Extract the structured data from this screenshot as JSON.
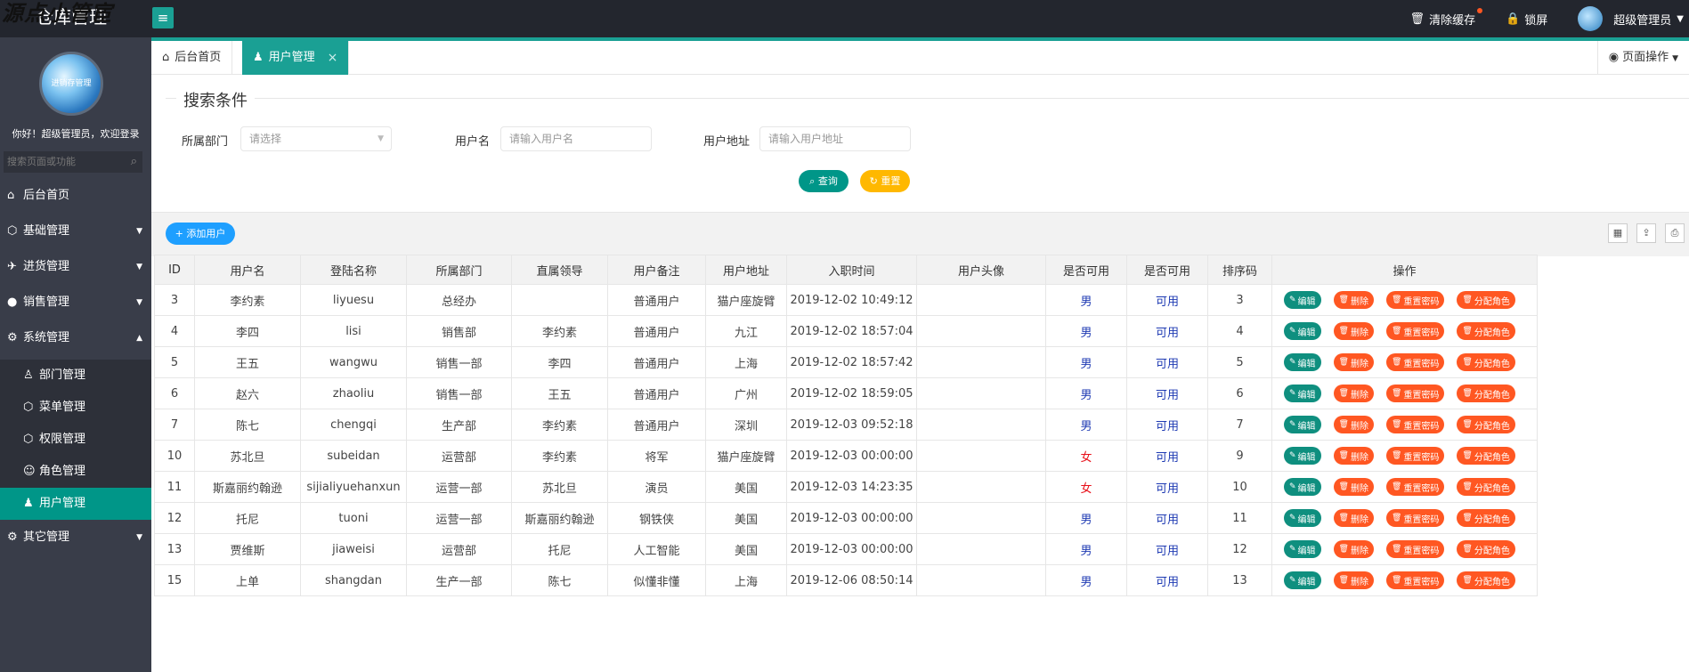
{
  "topbar": {
    "title": "仓库管理",
    "watermark": "源点小管宦",
    "clear_cache": "清除缓存",
    "lock_screen": "锁屏",
    "user": "超级管理员"
  },
  "sidebar": {
    "avatar_text": "进销存管理",
    "welcome": "你好！超级管理员，欢迎登录",
    "search_placeholder": "搜索页面或功能",
    "items": [
      {
        "label": "后台首页"
      },
      {
        "label": "基础管理"
      },
      {
        "label": "进货管理"
      },
      {
        "label": "销售管理"
      },
      {
        "label": "系统管理"
      },
      {
        "label": "其它管理"
      }
    ],
    "sub_items": [
      {
        "label": "部门管理"
      },
      {
        "label": "菜单管理"
      },
      {
        "label": "权限管理"
      },
      {
        "label": "角色管理"
      },
      {
        "label": "用户管理"
      }
    ]
  },
  "tabs": {
    "home": "后台首页",
    "current": "用户管理",
    "close": "×",
    "page_ops": "页面操作"
  },
  "search": {
    "title": "搜索条件",
    "dept_label": "所属部门",
    "dept_placeholder": "请选择",
    "name_label": "用户名",
    "name_placeholder": "请输入用户名",
    "addr_label": "用户地址",
    "addr_placeholder": "请输入用户地址",
    "query_btn": "查询",
    "reset_btn": "重置"
  },
  "toolbar": {
    "add_user": "添加用户"
  },
  "table": {
    "headers": [
      "ID",
      "用户名",
      "登陆名称",
      "所属部门",
      "直属领导",
      "用户备注",
      "用户地址",
      "入职时间",
      "用户头像",
      "是否可用",
      "是否可用",
      "排序码",
      "操作"
    ],
    "actions": {
      "edit": "编辑",
      "delete": "删除",
      "reset_pwd": "重置密码",
      "assign_role": "分配角色"
    },
    "rows": [
      {
        "id": "3",
        "name": "李约素",
        "login": "liyuesu",
        "dept": "总经办",
        "leader": "",
        "remark": "普通用户",
        "address": "猫户座旋臂",
        "hired": "2019-12-02 10:49:12",
        "avatar": "",
        "sex": "男",
        "avail": "可用",
        "order": "3"
      },
      {
        "id": "4",
        "name": "李四",
        "login": "lisi",
        "dept": "销售部",
        "leader": "李约素",
        "remark": "普通用户",
        "address": "九江",
        "hired": "2019-12-02 18:57:04",
        "avatar": "",
        "sex": "男",
        "avail": "可用",
        "order": "4"
      },
      {
        "id": "5",
        "name": "王五",
        "login": "wangwu",
        "dept": "销售一部",
        "leader": "李四",
        "remark": "普通用户",
        "address": "上海",
        "hired": "2019-12-02 18:57:42",
        "avatar": "",
        "sex": "男",
        "avail": "可用",
        "order": "5"
      },
      {
        "id": "6",
        "name": "赵六",
        "login": "zhaoliu",
        "dept": "销售一部",
        "leader": "王五",
        "remark": "普通用户",
        "address": "广州",
        "hired": "2019-12-02 18:59:05",
        "avatar": "",
        "sex": "男",
        "avail": "可用",
        "order": "6"
      },
      {
        "id": "7",
        "name": "陈七",
        "login": "chengqi",
        "dept": "生产部",
        "leader": "李约素",
        "remark": "普通用户",
        "address": "深圳",
        "hired": "2019-12-03 09:52:18",
        "avatar": "",
        "sex": "男",
        "avail": "可用",
        "order": "7"
      },
      {
        "id": "10",
        "name": "苏北旦",
        "login": "subeidan",
        "dept": "运营部",
        "leader": "李约素",
        "remark": "将军",
        "address": "猫户座旋臂",
        "hired": "2019-12-03 00:00:00",
        "avatar": "",
        "sex": "女",
        "avail": "可用",
        "order": "9"
      },
      {
        "id": "11",
        "name": "斯嘉丽约翰逊",
        "login": "sijialiyuehanxun",
        "dept": "运营一部",
        "leader": "苏北旦",
        "remark": "演员",
        "address": "美国",
        "hired": "2019-12-03 14:23:35",
        "avatar": "",
        "sex": "女",
        "avail": "可用",
        "order": "10"
      },
      {
        "id": "12",
        "name": "托尼",
        "login": "tuoni",
        "dept": "运营一部",
        "leader": "斯嘉丽约翰逊",
        "remark": "钢铁侠",
        "address": "美国",
        "hired": "2019-12-03 00:00:00",
        "avatar": "",
        "sex": "男",
        "avail": "可用",
        "order": "11"
      },
      {
        "id": "13",
        "name": "贾维斯",
        "login": "jiaweisi",
        "dept": "运营部",
        "leader": "托尼",
        "remark": "人工智能",
        "address": "美国",
        "hired": "2019-12-03 00:00:00",
        "avatar": "",
        "sex": "男",
        "avail": "可用",
        "order": "12"
      },
      {
        "id": "15",
        "name": "上单",
        "login": "shangdan",
        "dept": "生产一部",
        "leader": "陈七",
        "remark": "似懂非懂",
        "address": "上海",
        "hired": "2019-12-06 08:50:14",
        "avatar": "",
        "sex": "男",
        "avail": "可用",
        "order": "13"
      }
    ]
  }
}
